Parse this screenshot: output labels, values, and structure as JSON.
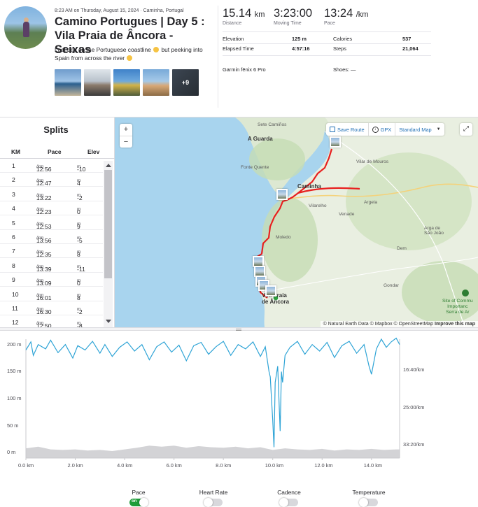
{
  "activity": {
    "meta_date": "8:23 AM on Thursday, August 15, 2024 · Caminha, Portugal",
    "title": "Camino Portugues | Day 5 : Vila Praia de Âncora - Seixas",
    "description_part1": "Last day on the Portuguese coastline",
    "description_part2": "but peeking into Spain from across the river",
    "more_photos": "+9"
  },
  "stats": {
    "distance": {
      "value": "15.14",
      "unit": "km",
      "label": "Distance"
    },
    "moving_time": {
      "value": "3:23:00",
      "label": "Moving Time"
    },
    "pace": {
      "value": "13:24",
      "unit": "/km",
      "label": "Pace"
    },
    "elevation": {
      "label": "Elevation",
      "value": "125 m"
    },
    "calories": {
      "label": "Calories",
      "value": "537"
    },
    "elapsed": {
      "label": "Elapsed Time",
      "value": "4:57:16"
    },
    "steps": {
      "label": "Steps",
      "value": "21,064"
    },
    "device": "Garmin fēnix 6 Pro",
    "shoes": "Shoes: —"
  },
  "splits": {
    "title": "Splits",
    "headers": {
      "km": "KM",
      "pace": "Pace",
      "elev": "Elev"
    },
    "pace_unit": "/km",
    "elev_unit": "m",
    "rows": [
      {
        "km": "1",
        "pace": "12:56",
        "elev": "-10"
      },
      {
        "km": "2",
        "pace": "12:47",
        "elev": "4"
      },
      {
        "km": "3",
        "pace": "13:22",
        "elev": "-2"
      },
      {
        "km": "4",
        "pace": "12:23",
        "elev": "0"
      },
      {
        "km": "5",
        "pace": "12:53",
        "elev": "9"
      },
      {
        "km": "6",
        "pace": "13:56",
        "elev": "-5"
      },
      {
        "km": "7",
        "pace": "12:35",
        "elev": "8"
      },
      {
        "km": "8",
        "pace": "13:39",
        "elev": "-11"
      },
      {
        "km": "9",
        "pace": "13:09",
        "elev": "0"
      },
      {
        "km": "10",
        "pace": "16:01",
        "elev": "8"
      },
      {
        "km": "11",
        "pace": "16:30",
        "elev": "-2"
      },
      {
        "km": "12",
        "pace": "12:50",
        "elev": "-8"
      }
    ]
  },
  "map": {
    "zoom_in": "+",
    "zoom_out": "−",
    "save_route": "Save Route",
    "gpx": "GPX",
    "map_type": "Standard Map",
    "attribution": "© Natural Earth Data © Mapbox © OpenStreetMap",
    "improve": "Improve this map",
    "labels": {
      "sete_camiños": "Sete Camiños",
      "a_guarda": "A Guarda",
      "fonte_quente": "Fonte Quente",
      "vilar_de_mouros": "Vilar de Mouros",
      "caminha": "Caminha",
      "argela": "Argela",
      "vilarelho": "Vilarelho",
      "venade": "Venade",
      "arga_de_sao_joao": "Arga de\nSão João",
      "moledo": "Moledo",
      "dem": "Dem",
      "gondar": "Gondar",
      "vila_praia": "Vila Praia\nde Âncora",
      "site_of_community": "Site of Commu\nImportanc\nSerra de Ar"
    },
    "route_color": "#e8201f",
    "water_color": "#a8d4ee"
  },
  "chart_data": {
    "type": "area",
    "title": "",
    "xlabel": "",
    "ylabel": "",
    "x_ticks": [
      "0.0 km",
      "2.0 km",
      "4.0 km",
      "6.0 km",
      "8.0 km",
      "10.0 km",
      "12.0 km",
      "14.0 km"
    ],
    "y_left_ticks": [
      "200 m",
      "150 m",
      "100 m",
      "50 m",
      "0 m"
    ],
    "y_right_ticks": [
      "16:40/km",
      "25:00/km",
      "33:20/km"
    ],
    "xlim": [
      0,
      15.14
    ],
    "ylim": [
      -10,
      210
    ],
    "series": [
      {
        "name": "Elevation",
        "color": "#c8c8cc",
        "x": [
          0,
          0.5,
          1,
          1.5,
          2,
          2.5,
          3,
          3.5,
          4,
          4.5,
          5,
          5.5,
          6,
          6.5,
          7,
          7.5,
          8,
          8.5,
          9,
          9.5,
          10,
          10.5,
          11,
          11.5,
          12,
          12.5,
          13,
          13.5,
          14,
          14.5,
          15,
          15.14
        ],
        "values": [
          8,
          11,
          6,
          5,
          6,
          4,
          5,
          3,
          6,
          9,
          13,
          11,
          13,
          9,
          12,
          10,
          9,
          11,
          8,
          10,
          5,
          8,
          6,
          5,
          7,
          4,
          6,
          5,
          7,
          5,
          6,
          6
        ]
      },
      {
        "name": "Pace",
        "color": "#2fa4d6",
        "x": [
          0,
          0.2,
          0.3,
          0.5,
          0.8,
          1.0,
          1.3,
          1.6,
          1.9,
          2.1,
          2.4,
          2.7,
          3.0,
          3.2,
          3.5,
          3.8,
          4.1,
          4.4,
          4.7,
          5.0,
          5.3,
          5.6,
          5.9,
          6.2,
          6.5,
          6.8,
          7.1,
          7.4,
          7.7,
          8.0,
          8.3,
          8.6,
          8.9,
          9.2,
          9.5,
          9.7,
          9.85,
          9.9,
          9.95,
          10.0,
          10.05,
          10.1,
          10.2,
          10.3,
          10.35,
          10.4,
          10.5,
          10.7,
          11.0,
          11.3,
          11.6,
          11.9,
          12.2,
          12.5,
          12.8,
          13.1,
          13.4,
          13.7,
          13.9,
          14.0,
          14.2,
          14.4,
          14.6,
          14.8,
          15.0,
          15.14
        ],
        "values": [
          190,
          205,
          180,
          200,
          192,
          208,
          185,
          200,
          175,
          198,
          190,
          206,
          184,
          200,
          178,
          195,
          205,
          188,
          200,
          172,
          196,
          205,
          186,
          199,
          170,
          198,
          204,
          182,
          196,
          206,
          180,
          200,
          192,
          205,
          178,
          196,
          150,
          140,
          100,
          60,
          10,
          130,
          160,
          40,
          150,
          130,
          180,
          195,
          206,
          182,
          200,
          188,
          204,
          176,
          198,
          206,
          184,
          200,
          160,
          145,
          192,
          210,
          195,
          205,
          212,
          200
        ]
      }
    ]
  }
}
